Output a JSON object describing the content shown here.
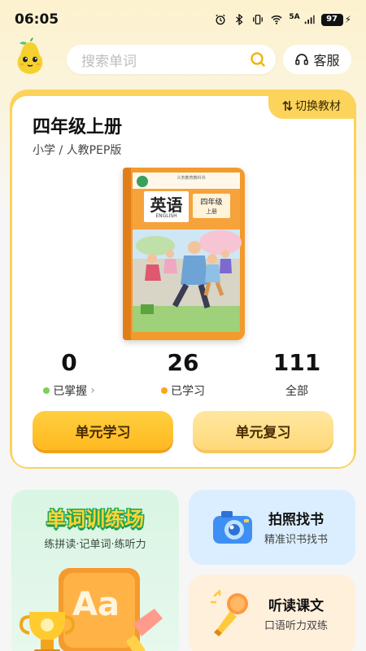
{
  "status_bar": {
    "time": "06:05",
    "network": "5A",
    "battery": "97"
  },
  "header": {
    "search_placeholder": "搜索单词",
    "service_label": "客服"
  },
  "textbook": {
    "switch_label": "切换教材",
    "title": "四年级上册",
    "subtitle": "小学 / 人教PEP版",
    "cover": {
      "title": "英语",
      "english": "ENGLISH",
      "grade": "四年级",
      "volume": "上册",
      "publisher": "义务教育教科书"
    }
  },
  "stats": [
    {
      "value": "0",
      "label": "已掌握",
      "dot_color": "#7ccf5a",
      "chevron": "›"
    },
    {
      "value": "26",
      "label": "已学习",
      "dot_color": "#f7a81b"
    },
    {
      "value": "111",
      "label": "全部"
    }
  ],
  "actions": {
    "unit_learn": "单元学习",
    "unit_review": "单元复习"
  },
  "features": {
    "trainer": {
      "title": "单词训练场",
      "subtitle": "练拼读·记单词·练听力"
    },
    "photo": {
      "title": "拍照找书",
      "subtitle": "精准识书找书"
    },
    "read": {
      "title": "听读课文",
      "subtitle": "口语听力双练"
    }
  },
  "colors": {
    "accent": "#fcd35b",
    "primary_button": "#ffbf2b",
    "secondary_button": "#ffe08c"
  }
}
